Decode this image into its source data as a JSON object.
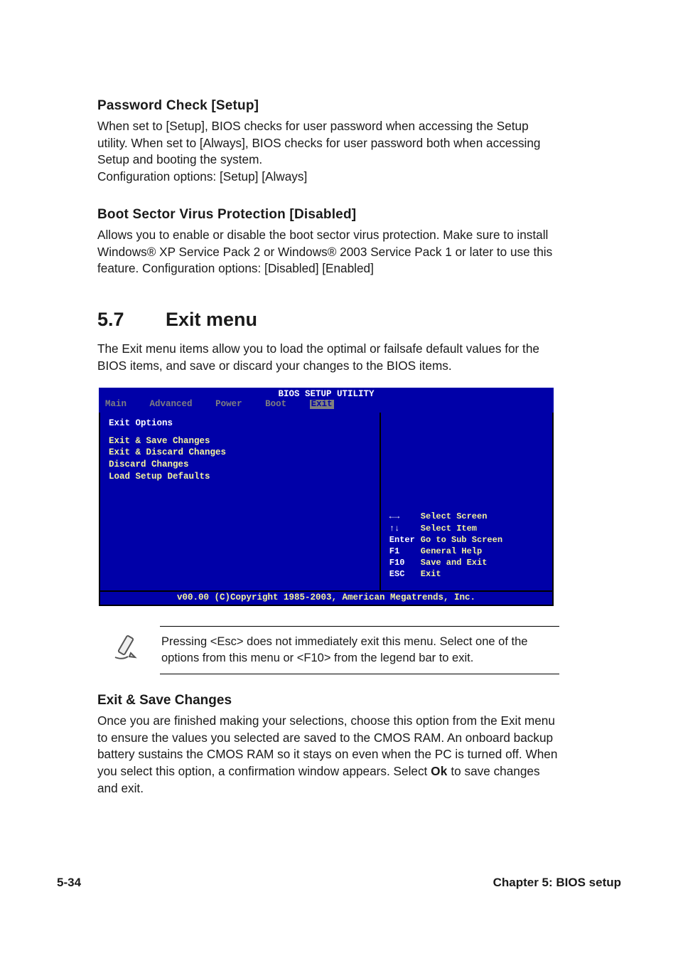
{
  "sections": {
    "pw_check": {
      "heading": "Password Check [Setup]",
      "body": "When set to [Setup], BIOS checks for user password when accessing the Setup utility. When set to [Always], BIOS checks for user password both when accessing Setup and booting the system.\nConfiguration options: [Setup] [Always]"
    },
    "boot_virus": {
      "heading": "Boot Sector Virus Protection [Disabled]",
      "body": "Allows you to enable or disable the boot sector virus protection. Make sure to install Windows® XP Service Pack 2 or Windows® 2003 Service Pack 1 or later to use this feature. Configuration options: [Disabled] [Enabled]"
    },
    "exit_title": {
      "num": "5.7",
      "label": "Exit menu"
    },
    "exit_intro": "The Exit menu items allow you to load the optimal or failsafe default values for the BIOS items, and save or discard your changes to the BIOS items.",
    "note": "Pressing <Esc> does not immediately exit this menu. Select one of the options from this menu or <F10> from the legend bar to exit.",
    "exit_save": {
      "heading": "Exit & Save Changes",
      "body_before_ok": "Once you are finished making your selections, choose this option from the Exit menu to ensure the values you selected are saved to the CMOS RAM. An onboard backup battery sustains the CMOS RAM so it stays on even when the PC is turned off. When you select this option, a confirmation window appears. Select ",
      "ok": "Ok",
      "body_after_ok": " to save changes and exit."
    }
  },
  "bios": {
    "title": "BIOS SETUP UTILITY",
    "tabs": [
      "Main",
      "Advanced",
      "Power",
      "Boot",
      "Exit"
    ],
    "active_tab": "Exit",
    "left_heading": "Exit Options",
    "options": [
      "Exit & Save Changes",
      "Exit & Discard Changes",
      "Discard Changes",
      "",
      "Load Setup Defaults"
    ],
    "legend": [
      {
        "key": "←→",
        "desc": "Select Screen"
      },
      {
        "key": "↑↓",
        "desc": "Select Item"
      },
      {
        "key": "Enter",
        "desc": "Go to Sub Screen"
      },
      {
        "key": "F1",
        "desc": "General Help"
      },
      {
        "key": "F10",
        "desc": "Save and Exit"
      },
      {
        "key": "ESC",
        "desc": "Exit"
      }
    ],
    "copyright": "v00.00 (C)Copyright 1985-2003, American Megatrends, Inc."
  },
  "footer": {
    "page": "5-34",
    "chapter": "Chapter 5: BIOS setup"
  }
}
